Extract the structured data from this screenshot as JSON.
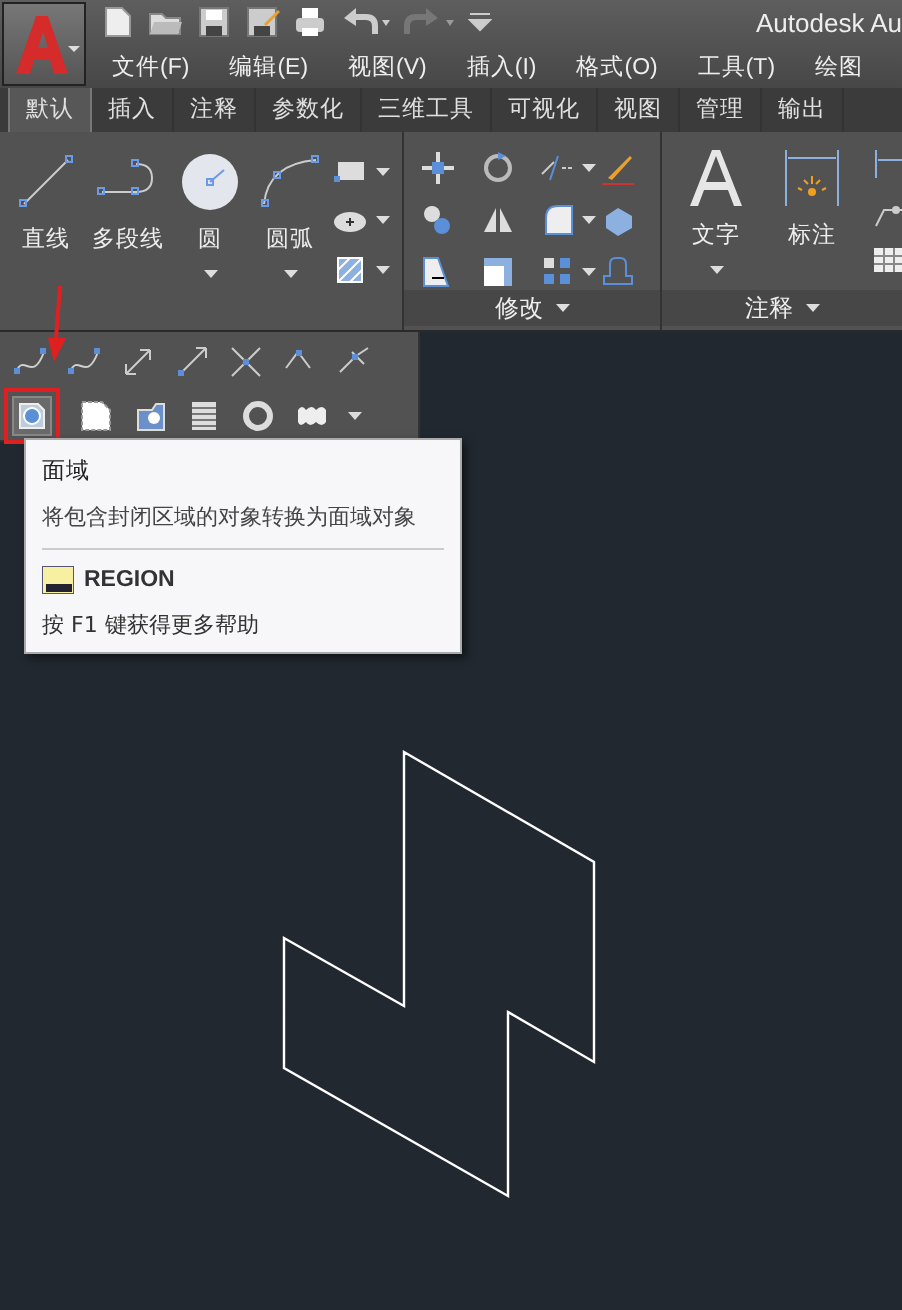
{
  "window": {
    "title": "Autodesk Au"
  },
  "menu": [
    "文件(F)",
    "编辑(E)",
    "视图(V)",
    "插入(I)",
    "格式(O)",
    "工具(T)",
    "绘图"
  ],
  "tabs": [
    {
      "label": "默认",
      "selected": true
    },
    {
      "label": "插入",
      "selected": false
    },
    {
      "label": "注释",
      "selected": false
    },
    {
      "label": "参数化",
      "selected": false
    },
    {
      "label": "三维工具",
      "selected": false
    },
    {
      "label": "可视化",
      "selected": false
    },
    {
      "label": "视图",
      "selected": false
    },
    {
      "label": "管理",
      "selected": false
    },
    {
      "label": "输出",
      "selected": false
    }
  ],
  "draw_panel": {
    "tools": [
      {
        "label": "直线",
        "kind": "line",
        "dropdown": false
      },
      {
        "label": "多段线",
        "kind": "polyline",
        "dropdown": false
      },
      {
        "label": "圆",
        "kind": "circle",
        "dropdown": true
      },
      {
        "label": "圆弧",
        "kind": "arc",
        "dropdown": true
      }
    ]
  },
  "modify_panel": {
    "title": "修改"
  },
  "annotation_panel": {
    "title": "注释",
    "tools": [
      {
        "label": "文字",
        "kind": "text",
        "dropdown": true
      },
      {
        "label": "标注",
        "kind": "dimension",
        "dropdown": false
      }
    ]
  },
  "tooltip": {
    "title": "面域",
    "description": "将包含封闭区域的对象转换为面域对象",
    "command": "REGION",
    "help": "按 F1 键获得更多帮助"
  }
}
